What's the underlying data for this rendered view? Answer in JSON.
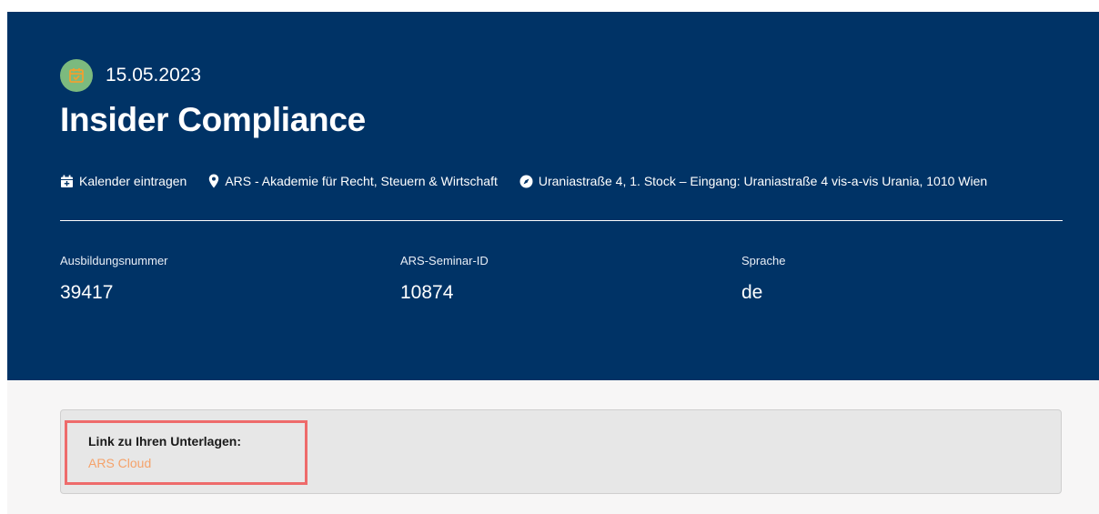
{
  "event": {
    "date": "15.05.2023",
    "title": "Insider Compliance",
    "calendar_label": "Kalender eintragen",
    "organizer": "ARS - Akademie für Recht, Steuern & Wirtschaft",
    "address": "Uraniastraße 4, 1. Stock – Eingang: Uraniastraße 4 vis-a-vis Urania, 1010 Wien"
  },
  "info": [
    {
      "label": "Ausbildungsnummer",
      "value": "39417"
    },
    {
      "label": "ARS-Seminar-ID",
      "value": "10874"
    },
    {
      "label": "Sprache",
      "value": "de"
    }
  ],
  "documents": {
    "label": "Link zu Ihren Unterlagen:",
    "link_text": "ARS Cloud"
  },
  "colors": {
    "hero_bg": "#003366",
    "calendar_badge": "#7cba7e",
    "link": "#f5a26a",
    "highlight": "#ee6b6b"
  },
  "icons": [
    "calendar-check-icon",
    "calendar-plus-icon",
    "map-pin-icon",
    "compass-icon"
  ]
}
